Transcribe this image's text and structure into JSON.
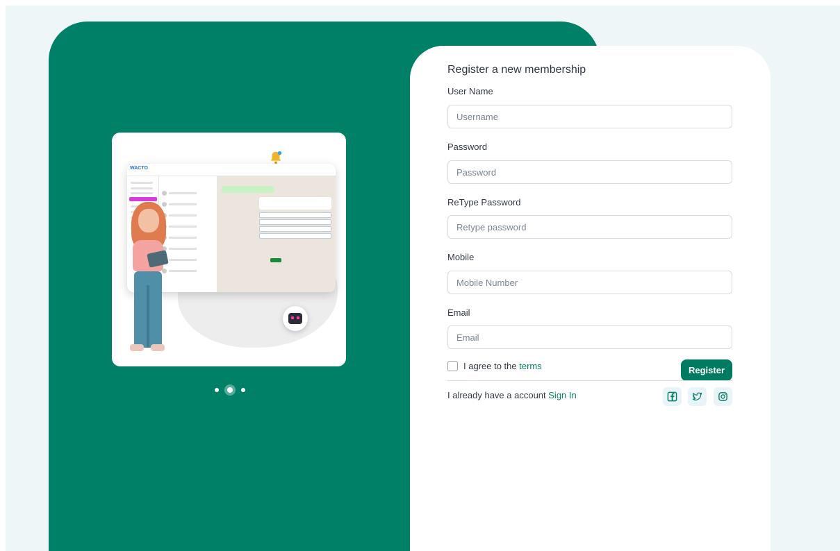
{
  "form": {
    "title": "Register a new membership",
    "fields": [
      {
        "label": "User Name",
        "placeholder": "Username"
      },
      {
        "label": "Password",
        "placeholder": "Password"
      },
      {
        "label": "ReType Password",
        "placeholder": "Retype password"
      },
      {
        "label": "Mobile",
        "placeholder": "Mobile Number"
      },
      {
        "label": "Email",
        "placeholder": "Email"
      }
    ],
    "agree_prefix": "I agree to the ",
    "agree_link": "terms",
    "register_label": "Register",
    "have_account_prefix": "I already have a account ",
    "sign_in_link": "Sign In"
  },
  "illustration": {
    "mockup_logo": "WACTO"
  },
  "carousel": {
    "slides": 3,
    "active_index": 1
  },
  "social": [
    "facebook-icon",
    "twitter-icon",
    "instagram-icon"
  ],
  "colors": {
    "brand_green": "#008066",
    "button_green": "#007a60",
    "link_green": "#0b7d64",
    "page_bg": "#eef6f8"
  }
}
